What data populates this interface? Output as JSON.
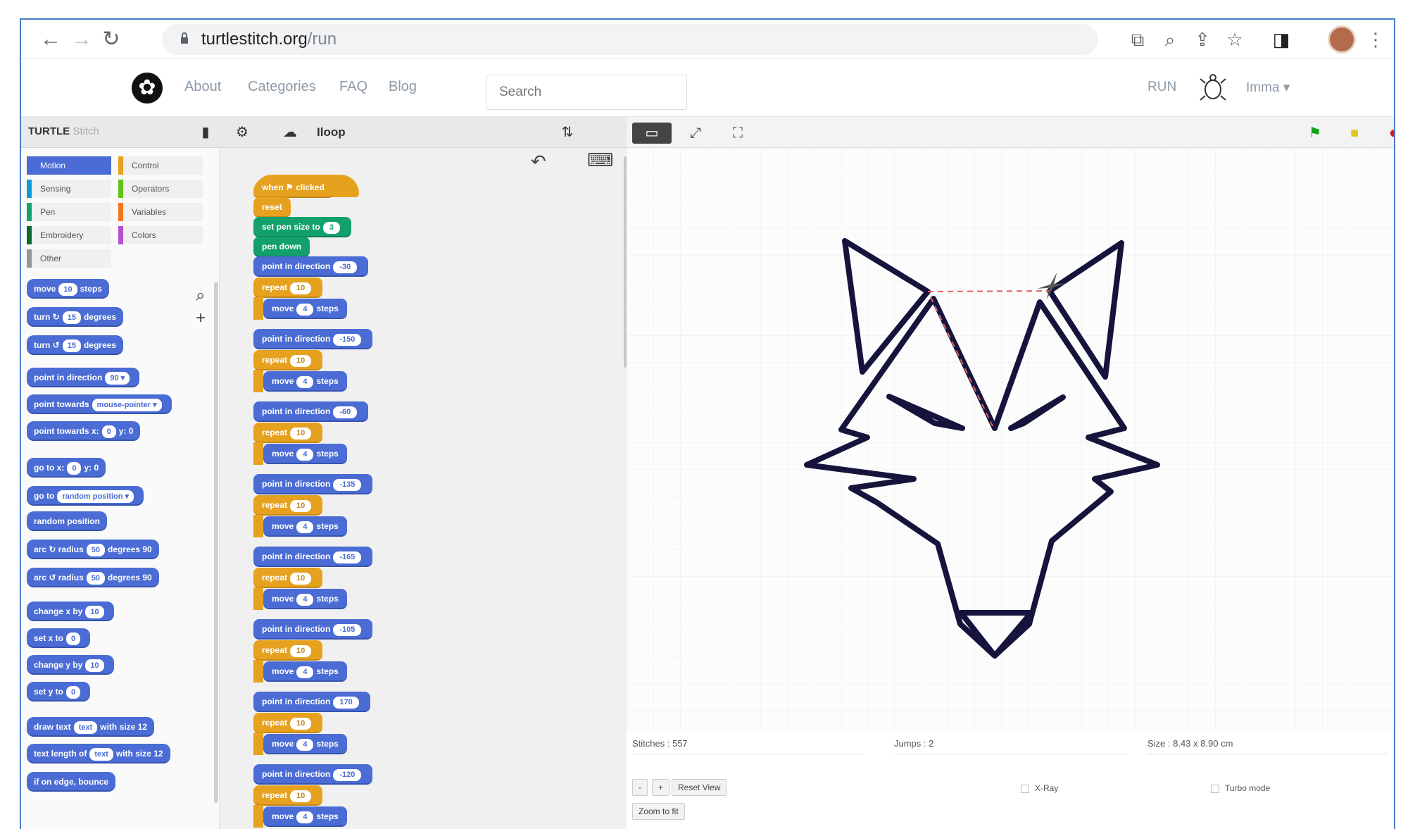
{
  "browser": {
    "url_host": "turtlestitch.org",
    "url_path": "/run"
  },
  "site": {
    "nav": [
      "About",
      "Categories",
      "FAQ",
      "Blog"
    ],
    "search_placeholder": "Search",
    "run_label": "RUN",
    "user_label": "Imma ▾"
  },
  "ide": {
    "brand": "TURTLE",
    "brand_sub": "Stitch",
    "project_name": "Iloop"
  },
  "palette": {
    "categories": [
      {
        "label": "Motion",
        "color": "#4a6cd4"
      },
      {
        "label": "Control",
        "color": "#e6a21f"
      },
      {
        "label": "Sensing",
        "color": "#0e9bd8"
      },
      {
        "label": "Operators",
        "color": "#62c213"
      },
      {
        "label": "Pen",
        "color": "#12a16d"
      },
      {
        "label": "Variables",
        "color": "#f3761d"
      },
      {
        "label": "Embroidery",
        "color": "#0a6b2f"
      },
      {
        "label": "Colors",
        "color": "#b84fd3"
      },
      {
        "label": "Other",
        "color": "#969696"
      }
    ],
    "blocks": [
      {
        "text": "move",
        "slot": "10",
        "suffix": "steps"
      },
      {
        "text": "turn ↻",
        "slot": "15",
        "suffix": "degrees"
      },
      {
        "text": "turn ↺",
        "slot": "15",
        "suffix": "degrees"
      },
      {
        "text": "point in direction",
        "slot": "90 ▾",
        "suffix": ""
      },
      {
        "text": "point towards",
        "slot": "mouse-pointer ▾",
        "suffix": ""
      },
      {
        "text": "point towards x:",
        "slot": "0",
        "suffix": "y: 0"
      },
      {
        "text": "go to x:",
        "slot": "0",
        "suffix": "y: 0"
      },
      {
        "text": "go to",
        "slot": "random position ▾",
        "suffix": ""
      },
      {
        "text": "random position",
        "slot": "",
        "suffix": ""
      },
      {
        "text": "arc ↻ radius",
        "slot": "50",
        "suffix": "degrees 90"
      },
      {
        "text": "arc ↺ radius",
        "slot": "50",
        "suffix": "degrees 90"
      },
      {
        "text": "change x by",
        "slot": "10",
        "suffix": ""
      },
      {
        "text": "set x to",
        "slot": "0",
        "suffix": ""
      },
      {
        "text": "change y by",
        "slot": "10",
        "suffix": ""
      },
      {
        "text": "set y to",
        "slot": "0",
        "suffix": ""
      },
      {
        "text": "draw text",
        "slot": "text",
        "suffix": "with size 12"
      },
      {
        "text": "text length of",
        "slot": "text",
        "suffix": "with size 12"
      },
      {
        "text": "if on edge, bounce",
        "slot": "",
        "suffix": ""
      }
    ]
  },
  "script": {
    "hat": "when ⚑ clicked",
    "reset": "reset",
    "pen_size": {
      "text": "set pen size to",
      "slot": "3"
    },
    "pen_down": "pen down",
    "steps": [
      {
        "dir": "-30",
        "repeat": "10",
        "move": "4"
      },
      {
        "dir": "-150",
        "repeat": "10",
        "move": "4"
      },
      {
        "dir": "-60",
        "repeat": "10",
        "move": "4"
      },
      {
        "dir": "-135",
        "repeat": "10",
        "move": "4"
      },
      {
        "dir": "-165",
        "repeat": "10",
        "move": "4"
      },
      {
        "dir": "-105",
        "repeat": "10",
        "move": "4"
      },
      {
        "dir": "170",
        "repeat": "10",
        "move": "4"
      },
      {
        "dir": "-120",
        "repeat": "10",
        "move": "4"
      }
    ]
  },
  "stage": {
    "stitches_label": "Stitches : 557",
    "jumps_label": "Jumps : 2",
    "size_label": "Size : 8.43 x 8.90 cm",
    "xray_label": "X-Ray",
    "turbo_label": "Turbo mode",
    "reset_view": "Reset View",
    "zoom_fit": "Zoom to fit",
    "drawing_color": "#14143c",
    "jump_color": "#e26060"
  }
}
